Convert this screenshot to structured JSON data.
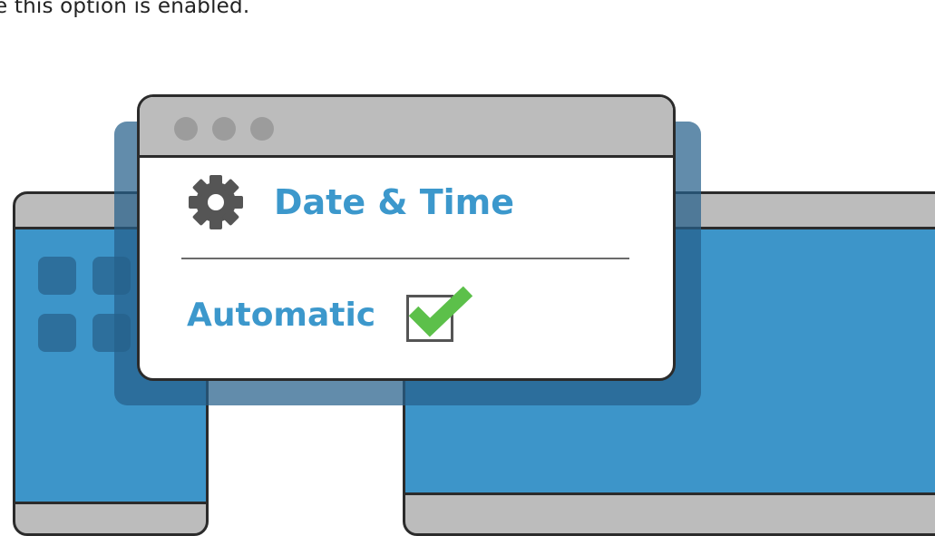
{
  "caption": {
    "text": "e this option is enabled."
  },
  "dialog": {
    "title": "Date & Time",
    "title_icon": "gear-icon",
    "options": [
      {
        "label": "Automatic",
        "checked": true
      }
    ]
  },
  "colors": {
    "accent": "#3c98cc",
    "screen": "#3d95c9",
    "check": "#5cc04a",
    "chrome": "#bcbcbc"
  }
}
